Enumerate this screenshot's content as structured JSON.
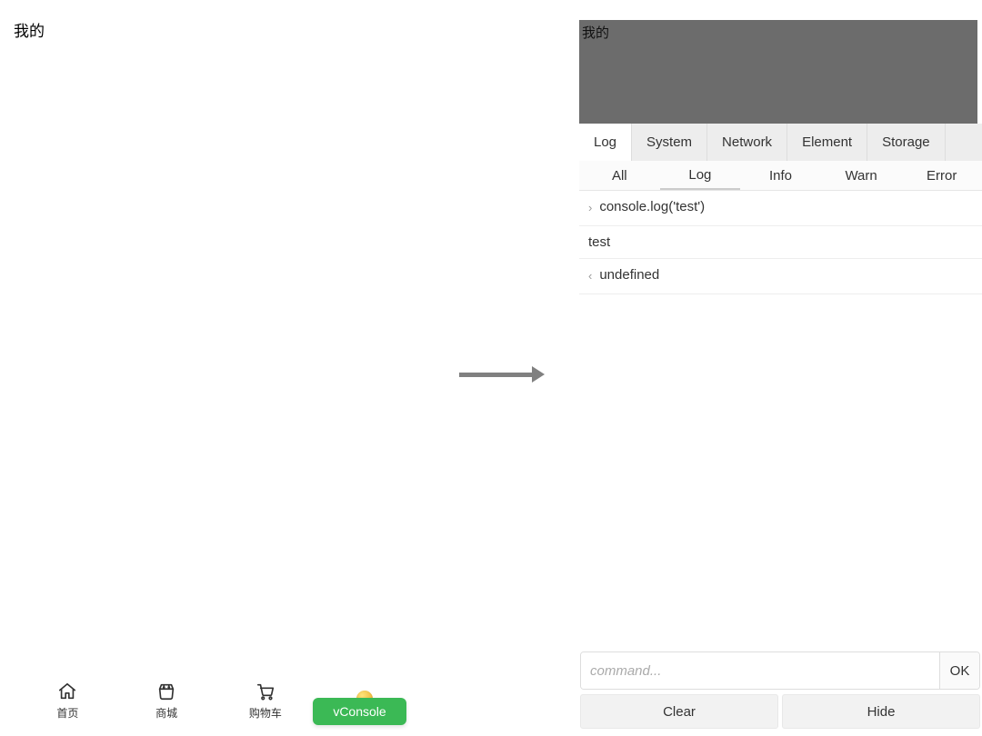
{
  "left": {
    "title": "我的",
    "tabbar": [
      {
        "label": "首页",
        "icon": "home"
      },
      {
        "label": "商城",
        "icon": "store"
      },
      {
        "label": "购物车",
        "icon": "cart"
      },
      {
        "label": "",
        "icon": "user-coin"
      }
    ],
    "vconsole_button": "vConsole"
  },
  "right": {
    "title": "我的",
    "tabs": [
      "Log",
      "System",
      "Network",
      "Element",
      "Storage"
    ],
    "active_tab_index": 0,
    "subtabs": [
      "All",
      "Log",
      "Info",
      "Warn",
      "Error"
    ],
    "active_subtab_index": 1,
    "log_entries": [
      {
        "caret": "›",
        "text": "console.log('test')"
      },
      {
        "caret": "",
        "text": "test"
      },
      {
        "caret": "‹",
        "text": "undefined"
      }
    ],
    "cmd_placeholder": "command...",
    "ok_label": "OK",
    "footer_buttons": [
      "Clear",
      "Hide"
    ]
  },
  "colors": {
    "vconsole_green": "#3bb955",
    "dim_header": "#6c6c6c"
  }
}
